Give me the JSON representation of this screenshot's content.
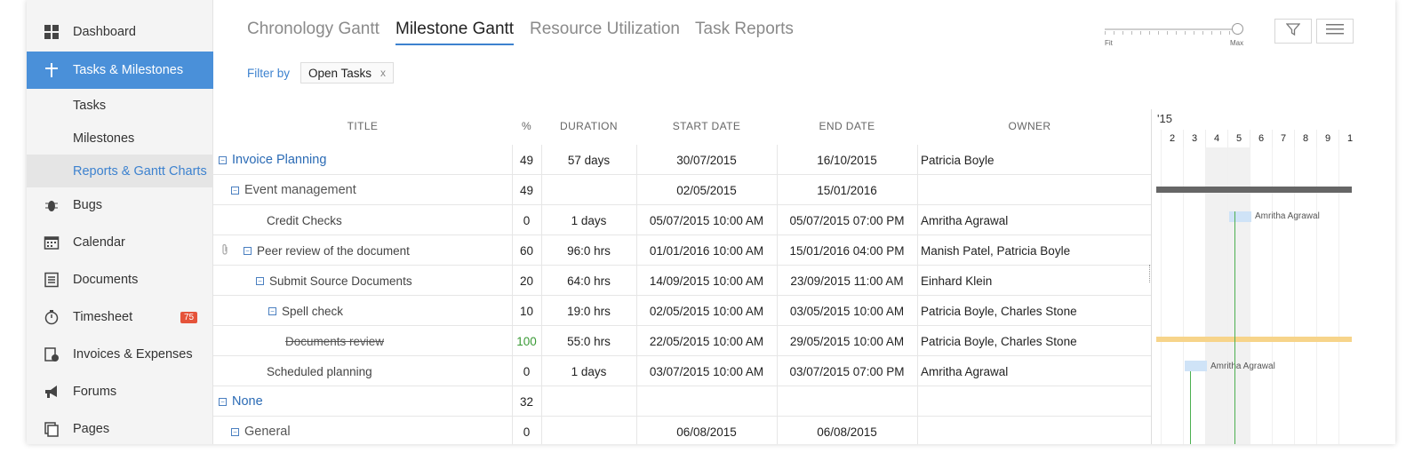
{
  "sidebar": {
    "items": [
      {
        "label": "Dashboard",
        "icon": "dashboard-icon"
      },
      {
        "label": "Tasks & Milestones",
        "icon": "tasks-icon"
      },
      {
        "label": "Bugs",
        "icon": "bug-icon"
      },
      {
        "label": "Calendar",
        "icon": "calendar-icon"
      },
      {
        "label": "Documents",
        "icon": "document-icon"
      },
      {
        "label": "Timesheet",
        "icon": "stopwatch-icon",
        "badge": "75"
      },
      {
        "label": "Invoices & Expenses",
        "icon": "invoice-icon"
      },
      {
        "label": "Forums",
        "icon": "megaphone-icon"
      },
      {
        "label": "Pages",
        "icon": "pages-icon"
      }
    ],
    "sub_items": [
      "Tasks",
      "Milestones",
      "Reports & Gantt Charts"
    ]
  },
  "tabs": [
    "Chronology Gantt",
    "Milestone Gantt",
    "Resource Utilization",
    "Task Reports"
  ],
  "filter": {
    "label": "Filter by",
    "chip": "Open Tasks",
    "chip_remove": "x"
  },
  "zoom": {
    "min_label": "Fit",
    "max_label": "Max",
    "level": 1.0
  },
  "table": {
    "headers": [
      "TITLE",
      "%",
      "DURATION",
      "START DATE",
      "END DATE",
      "OWNER"
    ],
    "rows": [
      {
        "title": "Invoice Planning",
        "pct": "49",
        "duration": "57 days",
        "start": "30/07/2015",
        "end": "16/10/2015",
        "owner": "Patricia Boyle"
      },
      {
        "title": "Event management",
        "pct": "49",
        "duration": "",
        "start": "02/05/2015",
        "end": "15/01/2016",
        "owner": ""
      },
      {
        "title": "Credit Checks",
        "pct": "0",
        "duration": "1 days",
        "start": "05/07/2015 10:00 AM",
        "end": "05/07/2015 07:00 PM",
        "owner": "Amritha Agrawal"
      },
      {
        "title": "Peer review of the document",
        "pct": "60",
        "duration": "96:0 hrs",
        "start": "01/01/2016 10:00 AM",
        "end": "15/01/2016 04:00 PM",
        "owner": "Manish Patel, Patricia Boyle"
      },
      {
        "title": "Submit Source Documents",
        "pct": "20",
        "duration": "64:0 hrs",
        "start": "14/09/2015 10:00 AM",
        "end": "23/09/2015 11:00 AM",
        "owner": "Einhard Klein"
      },
      {
        "title": "Spell check",
        "pct": "10",
        "duration": "19:0 hrs",
        "start": "02/05/2015 10:00 AM",
        "end": "03/05/2015 10:00 AM",
        "owner": "Patricia Boyle, Charles Stone"
      },
      {
        "title": "Documents review",
        "pct": "100",
        "duration": "55:0 hrs",
        "start": "22/05/2015 10:00 AM",
        "end": "29/05/2015 10:00 AM",
        "owner": "Patricia Boyle, Charles Stone"
      },
      {
        "title": "Scheduled planning",
        "pct": "0",
        "duration": "1 days",
        "start": "03/07/2015 10:00 AM",
        "end": "03/07/2015 07:00 PM",
        "owner": "Amritha Agrawal"
      },
      {
        "title": "None",
        "pct": "32",
        "duration": "",
        "start": "",
        "end": "",
        "owner": ""
      },
      {
        "title": "General",
        "pct": "0",
        "duration": "",
        "start": "06/08/2015",
        "end": "06/08/2015",
        "owner": ""
      }
    ]
  },
  "gantt": {
    "year": "'15",
    "days": [
      "2",
      "3",
      "4",
      "5",
      "6",
      "7",
      "8",
      "9",
      "1"
    ],
    "bar_labels": [
      "Amritha Agrawal",
      "Amritha Agrawal"
    ],
    "colors": {
      "summary": "#666666",
      "done": "#f7d48a",
      "task": "#cfe3f7",
      "dependency": "#4caf50"
    }
  },
  "colors": {
    "accent": "#4a90d9",
    "link": "#3d82cf",
    "badge": "#e5533a"
  }
}
